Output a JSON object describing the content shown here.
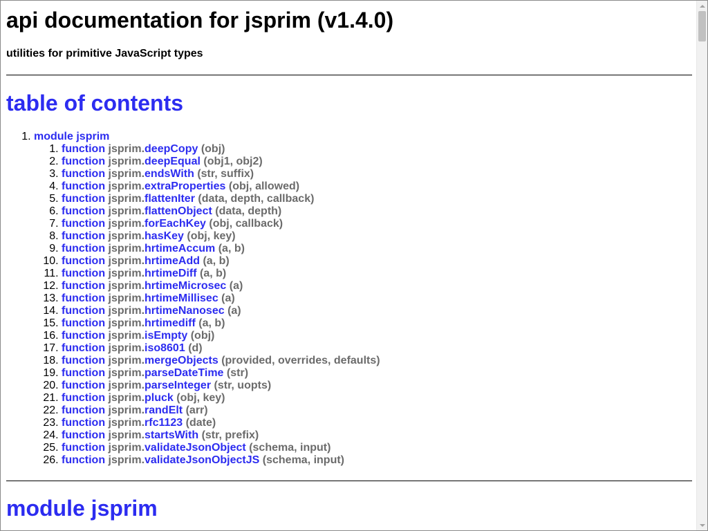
{
  "header": {
    "title": "api documentation for jsprim (v1.4.0)",
    "subtitle": "utilities for primitive JavaScript types"
  },
  "toc": {
    "heading": "table of contents",
    "module_keyword": "module",
    "module_name": "jsprim",
    "function_keyword": "function",
    "namespace": "jsprim.",
    "functions": [
      {
        "name": "deepCopy",
        "args": "(obj)"
      },
      {
        "name": "deepEqual",
        "args": "(obj1, obj2)"
      },
      {
        "name": "endsWith",
        "args": "(str, suffix)"
      },
      {
        "name": "extraProperties",
        "args": "(obj, allowed)"
      },
      {
        "name": "flattenIter",
        "args": "(data, depth, callback)"
      },
      {
        "name": "flattenObject",
        "args": "(data, depth)"
      },
      {
        "name": "forEachKey",
        "args": "(obj, callback)"
      },
      {
        "name": "hasKey",
        "args": "(obj, key)"
      },
      {
        "name": "hrtimeAccum",
        "args": "(a, b)"
      },
      {
        "name": "hrtimeAdd",
        "args": "(a, b)"
      },
      {
        "name": "hrtimeDiff",
        "args": "(a, b)"
      },
      {
        "name": "hrtimeMicrosec",
        "args": "(a)"
      },
      {
        "name": "hrtimeMillisec",
        "args": "(a)"
      },
      {
        "name": "hrtimeNanosec",
        "args": "(a)"
      },
      {
        "name": "hrtimediff",
        "args": "(a, b)"
      },
      {
        "name": "isEmpty",
        "args": "(obj)"
      },
      {
        "name": "iso8601",
        "args": "(d)"
      },
      {
        "name": "mergeObjects",
        "args": "(provided, overrides, defaults)"
      },
      {
        "name": "parseDateTime",
        "args": "(str)"
      },
      {
        "name": "parseInteger",
        "args": "(str, uopts)"
      },
      {
        "name": "pluck",
        "args": "(obj, key)"
      },
      {
        "name": "randElt",
        "args": "(arr)"
      },
      {
        "name": "rfc1123",
        "args": "(date)"
      },
      {
        "name": "startsWith",
        "args": "(str, prefix)"
      },
      {
        "name": "validateJsonObject",
        "args": "(schema, input)"
      },
      {
        "name": "validateJsonObjectJS",
        "args": "(schema, input)"
      }
    ]
  },
  "module_section": {
    "heading": "module jsprim"
  },
  "colors": {
    "link": "#2c2cf0",
    "muted": "#6b6b6b",
    "text": "#000000"
  },
  "icons": {
    "scroll_up": "triangle-up-icon",
    "scroll_down": "triangle-down-icon"
  }
}
